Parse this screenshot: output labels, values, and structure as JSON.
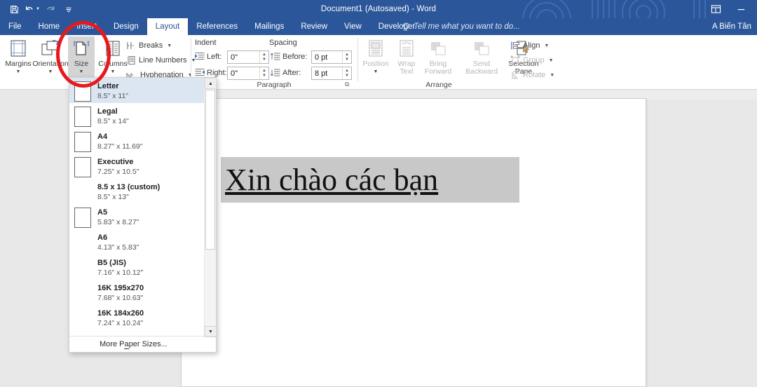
{
  "titlebar": {
    "document_title": "Document1 (Autosaved) - Word",
    "quick_access": [
      {
        "name": "save-icon",
        "label": "Save"
      },
      {
        "name": "undo-icon",
        "label": "Undo"
      },
      {
        "name": "redo-icon",
        "label": "Redo"
      },
      {
        "name": "customize-qat-icon",
        "label": "Customize Quick Access Toolbar"
      }
    ],
    "window_buttons": [
      {
        "name": "ribbon-display-options-icon",
        "label": "Ribbon Display Options"
      },
      {
        "name": "minimize-icon",
        "label": "Minimize"
      }
    ]
  },
  "tabs": [
    {
      "label": "File",
      "active": false
    },
    {
      "label": "Home",
      "active": false
    },
    {
      "label": "Insert",
      "active": false
    },
    {
      "label": "Design",
      "active": false
    },
    {
      "label": "Layout",
      "active": true
    },
    {
      "label": "References",
      "active": false
    },
    {
      "label": "Mailings",
      "active": false
    },
    {
      "label": "Review",
      "active": false
    },
    {
      "label": "View",
      "active": false
    },
    {
      "label": "Developer",
      "active": false
    }
  ],
  "tell_me": "Tell me what you want to do...",
  "account": "A Biến Tân",
  "ribbon": {
    "page_setup": {
      "label": "",
      "buttons": [
        {
          "label": "Margins",
          "icon": "margins-icon",
          "caret": "▼",
          "pressed": false
        },
        {
          "label": "Orientation",
          "icon": "orientation-icon",
          "caret": "▼",
          "pressed": false
        },
        {
          "label": "Size",
          "icon": "size-icon",
          "caret": "▼",
          "pressed": true
        },
        {
          "label": "Columns",
          "icon": "columns-icon",
          "caret": "▼",
          "pressed": false
        }
      ],
      "small_commands": [
        {
          "label": "Breaks",
          "icon": "breaks-icon",
          "caret": "▼"
        },
        {
          "label": "Line Numbers",
          "icon": "line-numbers-icon",
          "caret": "▼"
        },
        {
          "label": "Hyphenation",
          "icon": "hyphenation-icon",
          "caret": "▼"
        }
      ]
    },
    "paragraph": {
      "label": "Paragraph",
      "indent_header": "Indent",
      "spacing_header": "Spacing",
      "fields": [
        {
          "label": "Left:",
          "value": "0\"",
          "icon": "indent-left-icon"
        },
        {
          "label": "Right:",
          "value": "0\"",
          "icon": "indent-right-icon"
        },
        {
          "label": "Before:",
          "value": "0 pt",
          "icon": "spacing-before-icon"
        },
        {
          "label": "After:",
          "value": "8 pt",
          "icon": "spacing-after-icon"
        }
      ],
      "dialog_launcher": "⧉"
    },
    "arrange": {
      "label": "Arrange",
      "buttons": [
        {
          "label_top": "Position",
          "label_bottom": "",
          "icon": "position-icon",
          "caret": "▼",
          "disabled": true
        },
        {
          "label_top": "Wrap",
          "label_bottom": "Text",
          "icon": "wrap-text-icon",
          "caret": "▼",
          "disabled": true
        },
        {
          "label_top": "Bring",
          "label_bottom": "Forward",
          "icon": "bring-forward-icon",
          "caret": "▼",
          "disabled": true
        },
        {
          "label_top": "Send",
          "label_bottom": "Backward",
          "icon": "send-backward-icon",
          "caret": "▼",
          "disabled": true
        },
        {
          "label_top": "Selection",
          "label_bottom": "Pane",
          "icon": "selection-pane-icon",
          "caret": "",
          "disabled": false
        }
      ],
      "small_commands": [
        {
          "label": "Align",
          "icon": "align-icon",
          "caret": "▼",
          "disabled": false
        },
        {
          "label": "Group",
          "icon": "group-icon",
          "caret": "▼",
          "disabled": true
        },
        {
          "label": "Rotate",
          "icon": "rotate-icon",
          "caret": "▼",
          "disabled": true
        }
      ]
    },
    "collapse_ribbon": "▲"
  },
  "size_dropdown": {
    "items": [
      {
        "name": "Letter",
        "dims": "8.5\" x 11\"",
        "selected": true,
        "thumb": true
      },
      {
        "name": "Legal",
        "dims": "8.5\" x 14\"",
        "selected": false,
        "thumb": true
      },
      {
        "name": "A4",
        "dims": "8.27\" x 11.69\"",
        "selected": false,
        "thumb": true
      },
      {
        "name": "Executive",
        "dims": "7.25\" x 10.5\"",
        "selected": false,
        "thumb": true
      },
      {
        "name": "8.5 x 13 (custom)",
        "dims": "8.5\" x 13\"",
        "selected": false,
        "thumb": false
      },
      {
        "name": "A5",
        "dims": "5.83\" x 8.27\"",
        "selected": false,
        "thumb": true
      },
      {
        "name": "A6",
        "dims": "4.13\" x 5.83\"",
        "selected": false,
        "thumb": false
      },
      {
        "name": "B5 (JIS)",
        "dims": "7.16\" x 10.12\"",
        "selected": false,
        "thumb": false
      },
      {
        "name": "16K 195x270",
        "dims": "7.68\" x 10.63\"",
        "selected": false,
        "thumb": false
      },
      {
        "name": "16K 184x260",
        "dims": "7.24\" x 10.24\"",
        "selected": false,
        "thumb": false
      }
    ],
    "footer": {
      "pre": "More P",
      "accel": "a",
      "post": "per Sizes..."
    },
    "scroll_up": "▲",
    "scroll_down": "▼"
  },
  "document": {
    "body_text": "Xin chào các bạn"
  },
  "annotation": {
    "color": "#e8191c",
    "shape": "ellipse",
    "target": "size-button"
  }
}
